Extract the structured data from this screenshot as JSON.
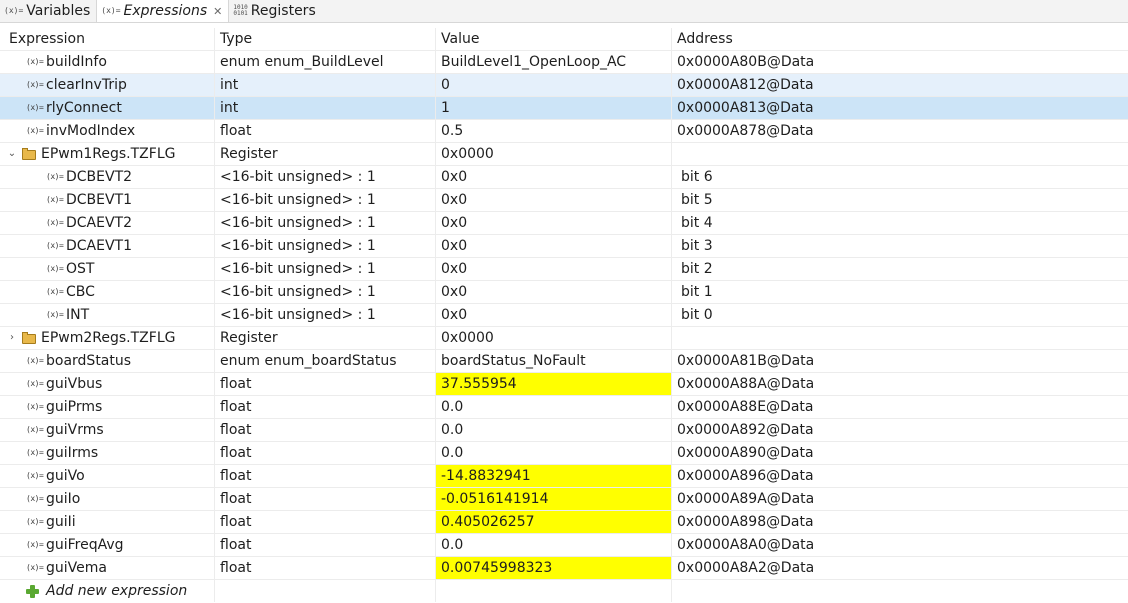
{
  "tabs": [
    {
      "label": "Variables",
      "icon": "(x)=",
      "active": false
    },
    {
      "label": "Expressions",
      "icon": "variable-icon",
      "active": true
    },
    {
      "label": "Registers",
      "icon": "binary-icon",
      "active": false
    }
  ],
  "tab_icon_text": {
    "variables": "(x)=",
    "expressions": "(x)=",
    "registers_top": "1010",
    "registers_bottom": "0101"
  },
  "columns": {
    "expression": "Expression",
    "type": "Type",
    "value": "Value",
    "address": "Address"
  },
  "var_icon_text": "(x)=",
  "rows": [
    {
      "name": "buildInfo",
      "type": "enum enum_BuildLevel",
      "value": "BuildLevel1_OpenLoop_AC",
      "address": "0x0000A80B@Data"
    },
    {
      "name": "clearInvTrip",
      "type": "int",
      "value": "0",
      "address": "0x0000A812@Data"
    },
    {
      "name": "rlyConnect",
      "type": "int",
      "value": "1",
      "address": "0x0000A813@Data"
    },
    {
      "name": "invModIndex",
      "type": "float",
      "value": "0.5",
      "address": "0x0000A878@Data"
    },
    {
      "name": "EPwm1Regs.TZFLG",
      "type": "Register",
      "value": "0x0000",
      "address": ""
    },
    {
      "name": "DCBEVT2",
      "type": "<16-bit unsigned> : 1",
      "value": "0x0",
      "address": "bit 6"
    },
    {
      "name": "DCBEVT1",
      "type": "<16-bit unsigned> : 1",
      "value": "0x0",
      "address": "bit 5"
    },
    {
      "name": "DCAEVT2",
      "type": "<16-bit unsigned> : 1",
      "value": "0x0",
      "address": "bit 4"
    },
    {
      "name": "DCAEVT1",
      "type": "<16-bit unsigned> : 1",
      "value": "0x0",
      "address": "bit 3"
    },
    {
      "name": "OST",
      "type": "<16-bit unsigned> : 1",
      "value": "0x0",
      "address": "bit 2"
    },
    {
      "name": "CBC",
      "type": "<16-bit unsigned> : 1",
      "value": "0x0",
      "address": "bit 1"
    },
    {
      "name": "INT",
      "type": "<16-bit unsigned> : 1",
      "value": "0x0",
      "address": "bit 0"
    },
    {
      "name": "EPwm2Regs.TZFLG",
      "type": "Register",
      "value": "0x0000",
      "address": ""
    },
    {
      "name": "boardStatus",
      "type": "enum enum_boardStatus",
      "value": "boardStatus_NoFault",
      "address": "0x0000A81B@Data"
    },
    {
      "name": "guiVbus",
      "type": "float",
      "value": "37.555954",
      "address": "0x0000A88A@Data"
    },
    {
      "name": "guiPrms",
      "type": "float",
      "value": "0.0",
      "address": "0x0000A88E@Data"
    },
    {
      "name": "guiVrms",
      "type": "float",
      "value": "0.0",
      "address": "0x0000A892@Data"
    },
    {
      "name": "guiIrms",
      "type": "float",
      "value": "0.0",
      "address": "0x0000A890@Data"
    },
    {
      "name": "guiVo",
      "type": "float",
      "value": "-14.8832941",
      "address": "0x0000A896@Data"
    },
    {
      "name": "guiIo",
      "type": "float",
      "value": "-0.0516141914",
      "address": "0x0000A89A@Data"
    },
    {
      "name": "guiIi",
      "type": "float",
      "value": "0.405026257",
      "address": "0x0000A898@Data"
    },
    {
      "name": "guiFreqAvg",
      "type": "float",
      "value": "0.0",
      "address": "0x0000A8A0@Data"
    },
    {
      "name": "guiVema",
      "type": "float",
      "value": "0.00745998323",
      "address": "0x0000A8A2@Data"
    }
  ],
  "add_expression_label": "Add new expression",
  "colors": {
    "highlight": "#ffff00",
    "selected": "#cce4f7",
    "selected_light": "#e5f0fb"
  }
}
